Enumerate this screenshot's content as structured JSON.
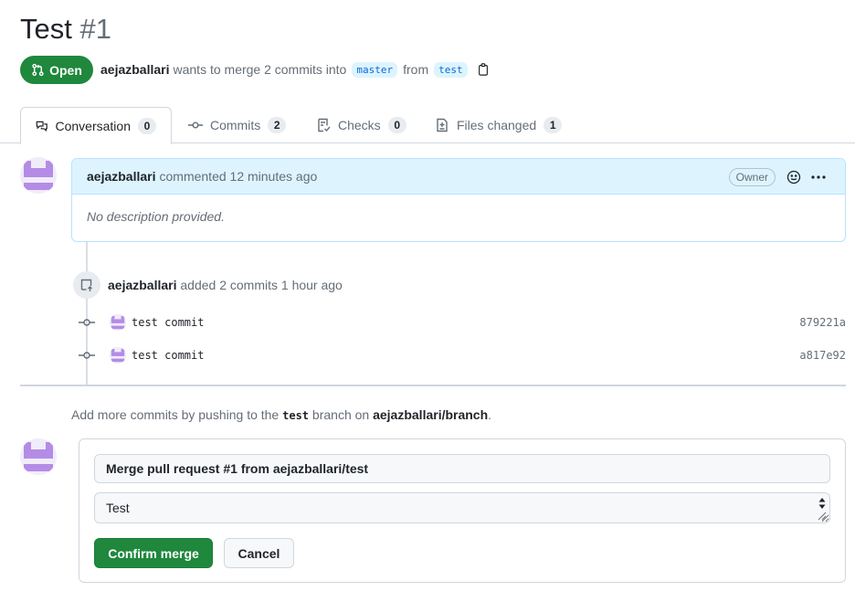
{
  "pr": {
    "title": "Test",
    "number": "#1",
    "state": "Open",
    "author": "aejazballari",
    "merge_text": "wants to merge 2 commits into",
    "base_branch": "master",
    "from_text": "from",
    "head_branch": "test"
  },
  "tabs": [
    {
      "label": "Conversation",
      "count": "0"
    },
    {
      "label": "Commits",
      "count": "2"
    },
    {
      "label": "Checks",
      "count": "0"
    },
    {
      "label": "Files changed",
      "count": "1"
    }
  ],
  "comment": {
    "author": "aejazballari",
    "action": "commented 12 minutes ago",
    "badge": "Owner",
    "body": "No description provided."
  },
  "commits_event": {
    "author": "aejazballari",
    "text": "added 2 commits 1 hour ago",
    "commits": [
      {
        "message": "test commit",
        "sha": "879221a"
      },
      {
        "message": "test commit",
        "sha": "a817e92"
      }
    ]
  },
  "hint": {
    "prefix": "Add more commits by pushing to the",
    "branch": "test",
    "middle": "branch on",
    "repo": "aejazballari/branch",
    "suffix": "."
  },
  "merge": {
    "title_value": "Merge pull request #1 from aejazballari/test",
    "body_value": "Test",
    "confirm_label": "Confirm merge",
    "cancel_label": "Cancel"
  },
  "colors": {
    "open_green": "#1f883d",
    "comment_header_bg": "#ddf4ff",
    "avatar_purple": "#b48ce6"
  }
}
